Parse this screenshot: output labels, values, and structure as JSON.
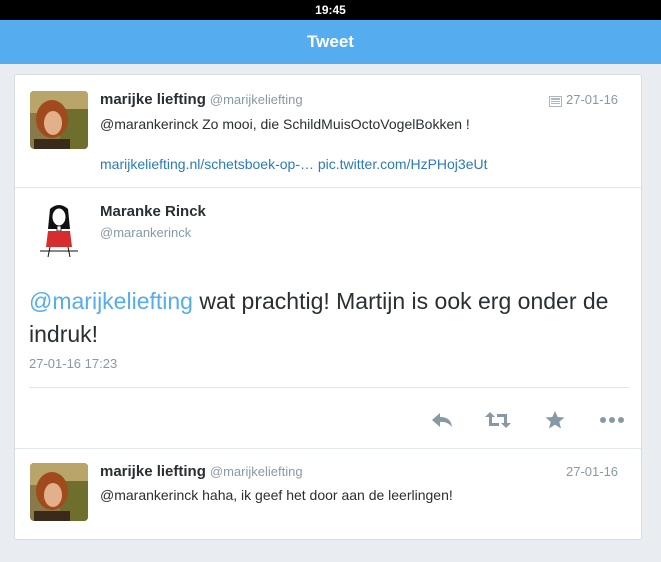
{
  "status_bar": {
    "time": "19:45"
  },
  "nav": {
    "title": "Tweet"
  },
  "tweet_parent": {
    "name": "marijke liefting",
    "handle": "@marijkeliefting",
    "date": "27-01-16",
    "text": "@marankerinck Zo mooi, die SchildMuisOctoVogelBokken !",
    "link1": "marijkeliefting.nl/schetsboek-op-…",
    "link2": "pic.twitter.com/HzPHoj3eUt"
  },
  "tweet_main": {
    "name": "Maranke Rinck",
    "handle": "@marankerinck",
    "mention": "@marijkeliefting",
    "text": " wat prachtig! Martijn is ook erg onder de indruk!",
    "timestamp": "27-01-16 17:23"
  },
  "tweet_reply": {
    "name": "marijke liefting",
    "handle": "@marijkeliefting",
    "date": "27-01-16",
    "text": "@marankerinck haha, ik geef het door aan de leerlingen!"
  },
  "icons": [
    "reply-icon",
    "retweet-icon",
    "favorite-star-icon",
    "more-dots-icon",
    "media-card-icon"
  ],
  "colors": {
    "nav": "#55acee",
    "link": "#2b7bb9",
    "mention": "#55acee",
    "muted": "#8899a6"
  }
}
